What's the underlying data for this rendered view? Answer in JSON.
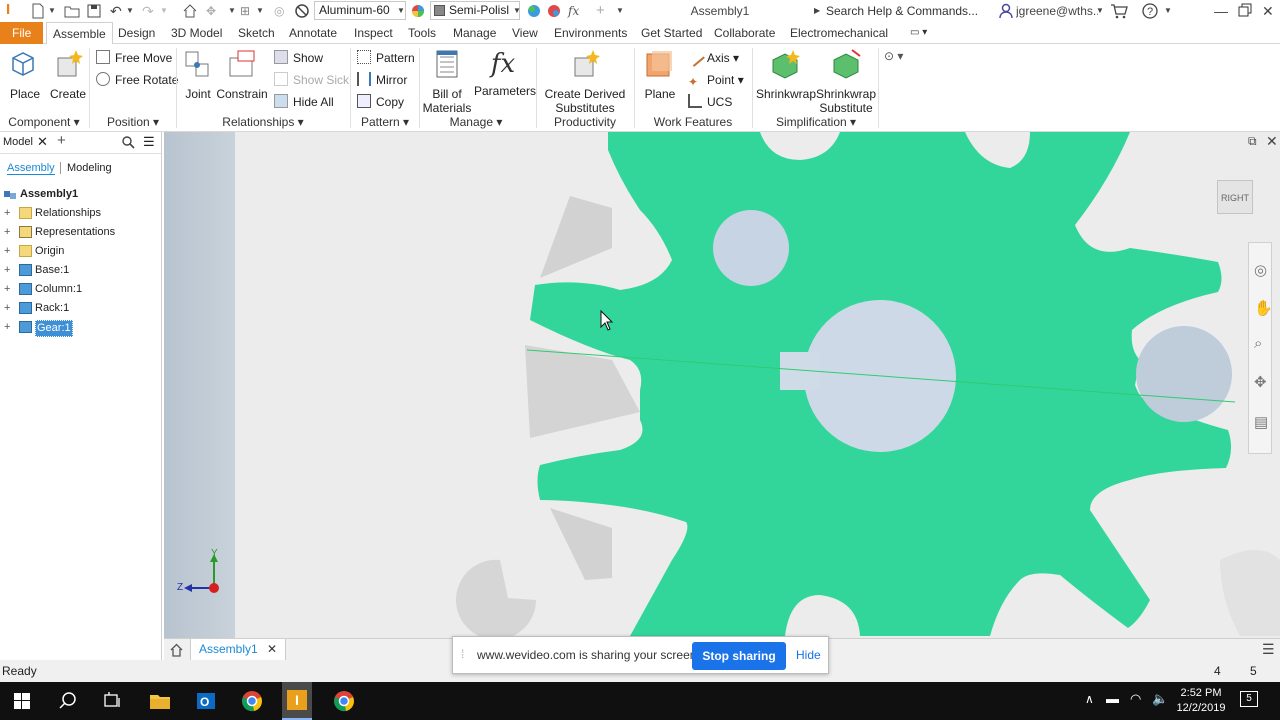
{
  "quick_access": {
    "material": "Aluminum-60",
    "appearance": "Semi-Polisl",
    "doc_title": "Assembly1",
    "search_placeholder": "Search Help & Commands...",
    "user": "jgreene@wths..."
  },
  "tabs": [
    "File",
    "Assemble",
    "Design",
    "3D Model",
    "Sketch",
    "Annotate",
    "Inspect",
    "Tools",
    "Manage",
    "View",
    "Environments",
    "Get Started",
    "Collaborate",
    "Electromechanical"
  ],
  "active_tab": "Assemble",
  "ribbon": {
    "component": {
      "place": "Place",
      "create": "Create",
      "label": "Component"
    },
    "position": {
      "free_move": "Free Move",
      "free_rotate": "Free Rotate",
      "label": "Position"
    },
    "relationships": {
      "joint": "Joint",
      "constrain": "Constrain",
      "show": "Show",
      "show_sick": "Show Sick",
      "hide_all": "Hide All",
      "label": "Relationships"
    },
    "pattern": {
      "pattern": "Pattern",
      "mirror": "Mirror",
      "copy": "Copy",
      "label": "Pattern"
    },
    "manage": {
      "bom_line1": "Bill of",
      "bom_line2": "Materials",
      "parameters": "Parameters",
      "label": "Manage"
    },
    "productivity": {
      "line1": "Create Derived",
      "line2": "Substitutes",
      "label": "Productivity"
    },
    "work_features": {
      "plane": "Plane",
      "axis": "Axis",
      "point": "Point",
      "ucs": "UCS",
      "label": "Work Features"
    },
    "simplification": {
      "shrinkwrap": "Shrinkwrap",
      "sub_line1": "Shrinkwrap",
      "sub_line2": "Substitute",
      "label": "Simplification"
    }
  },
  "browser": {
    "title": "Model",
    "tab_assembly": "Assembly",
    "tab_modeling": "Modeling",
    "root": "Assembly1",
    "items": [
      {
        "label": "Relationships",
        "icon": "folder-icon"
      },
      {
        "label": "Representations",
        "icon": "representations-icon"
      },
      {
        "label": "Origin",
        "icon": "folder-icon"
      },
      {
        "label": "Base:1",
        "icon": "part-icon"
      },
      {
        "label": "Column:1",
        "icon": "part-icon"
      },
      {
        "label": "Rack:1",
        "icon": "part-icon"
      },
      {
        "label": "Gear:1",
        "icon": "part-icon",
        "selected": true
      }
    ]
  },
  "viewcube_label": "RIGHT",
  "triad": {
    "y": "Y",
    "z": "Z"
  },
  "doc_tab": "Assembly1",
  "status": {
    "text": "Ready",
    "n1": "4",
    "n2": "5"
  },
  "share_bar": {
    "message": "www.wevideo.com is sharing your screen.",
    "stop": "Stop sharing",
    "hide": "Hide"
  },
  "taskbar": {
    "time": "2:52 PM",
    "date": "12/2/2019",
    "notifications": "5"
  },
  "colors": {
    "gear": "#33d69a",
    "file_tab": "#e9811b",
    "accent": "#1a8ad4",
    "share_button": "#1a73e8"
  }
}
